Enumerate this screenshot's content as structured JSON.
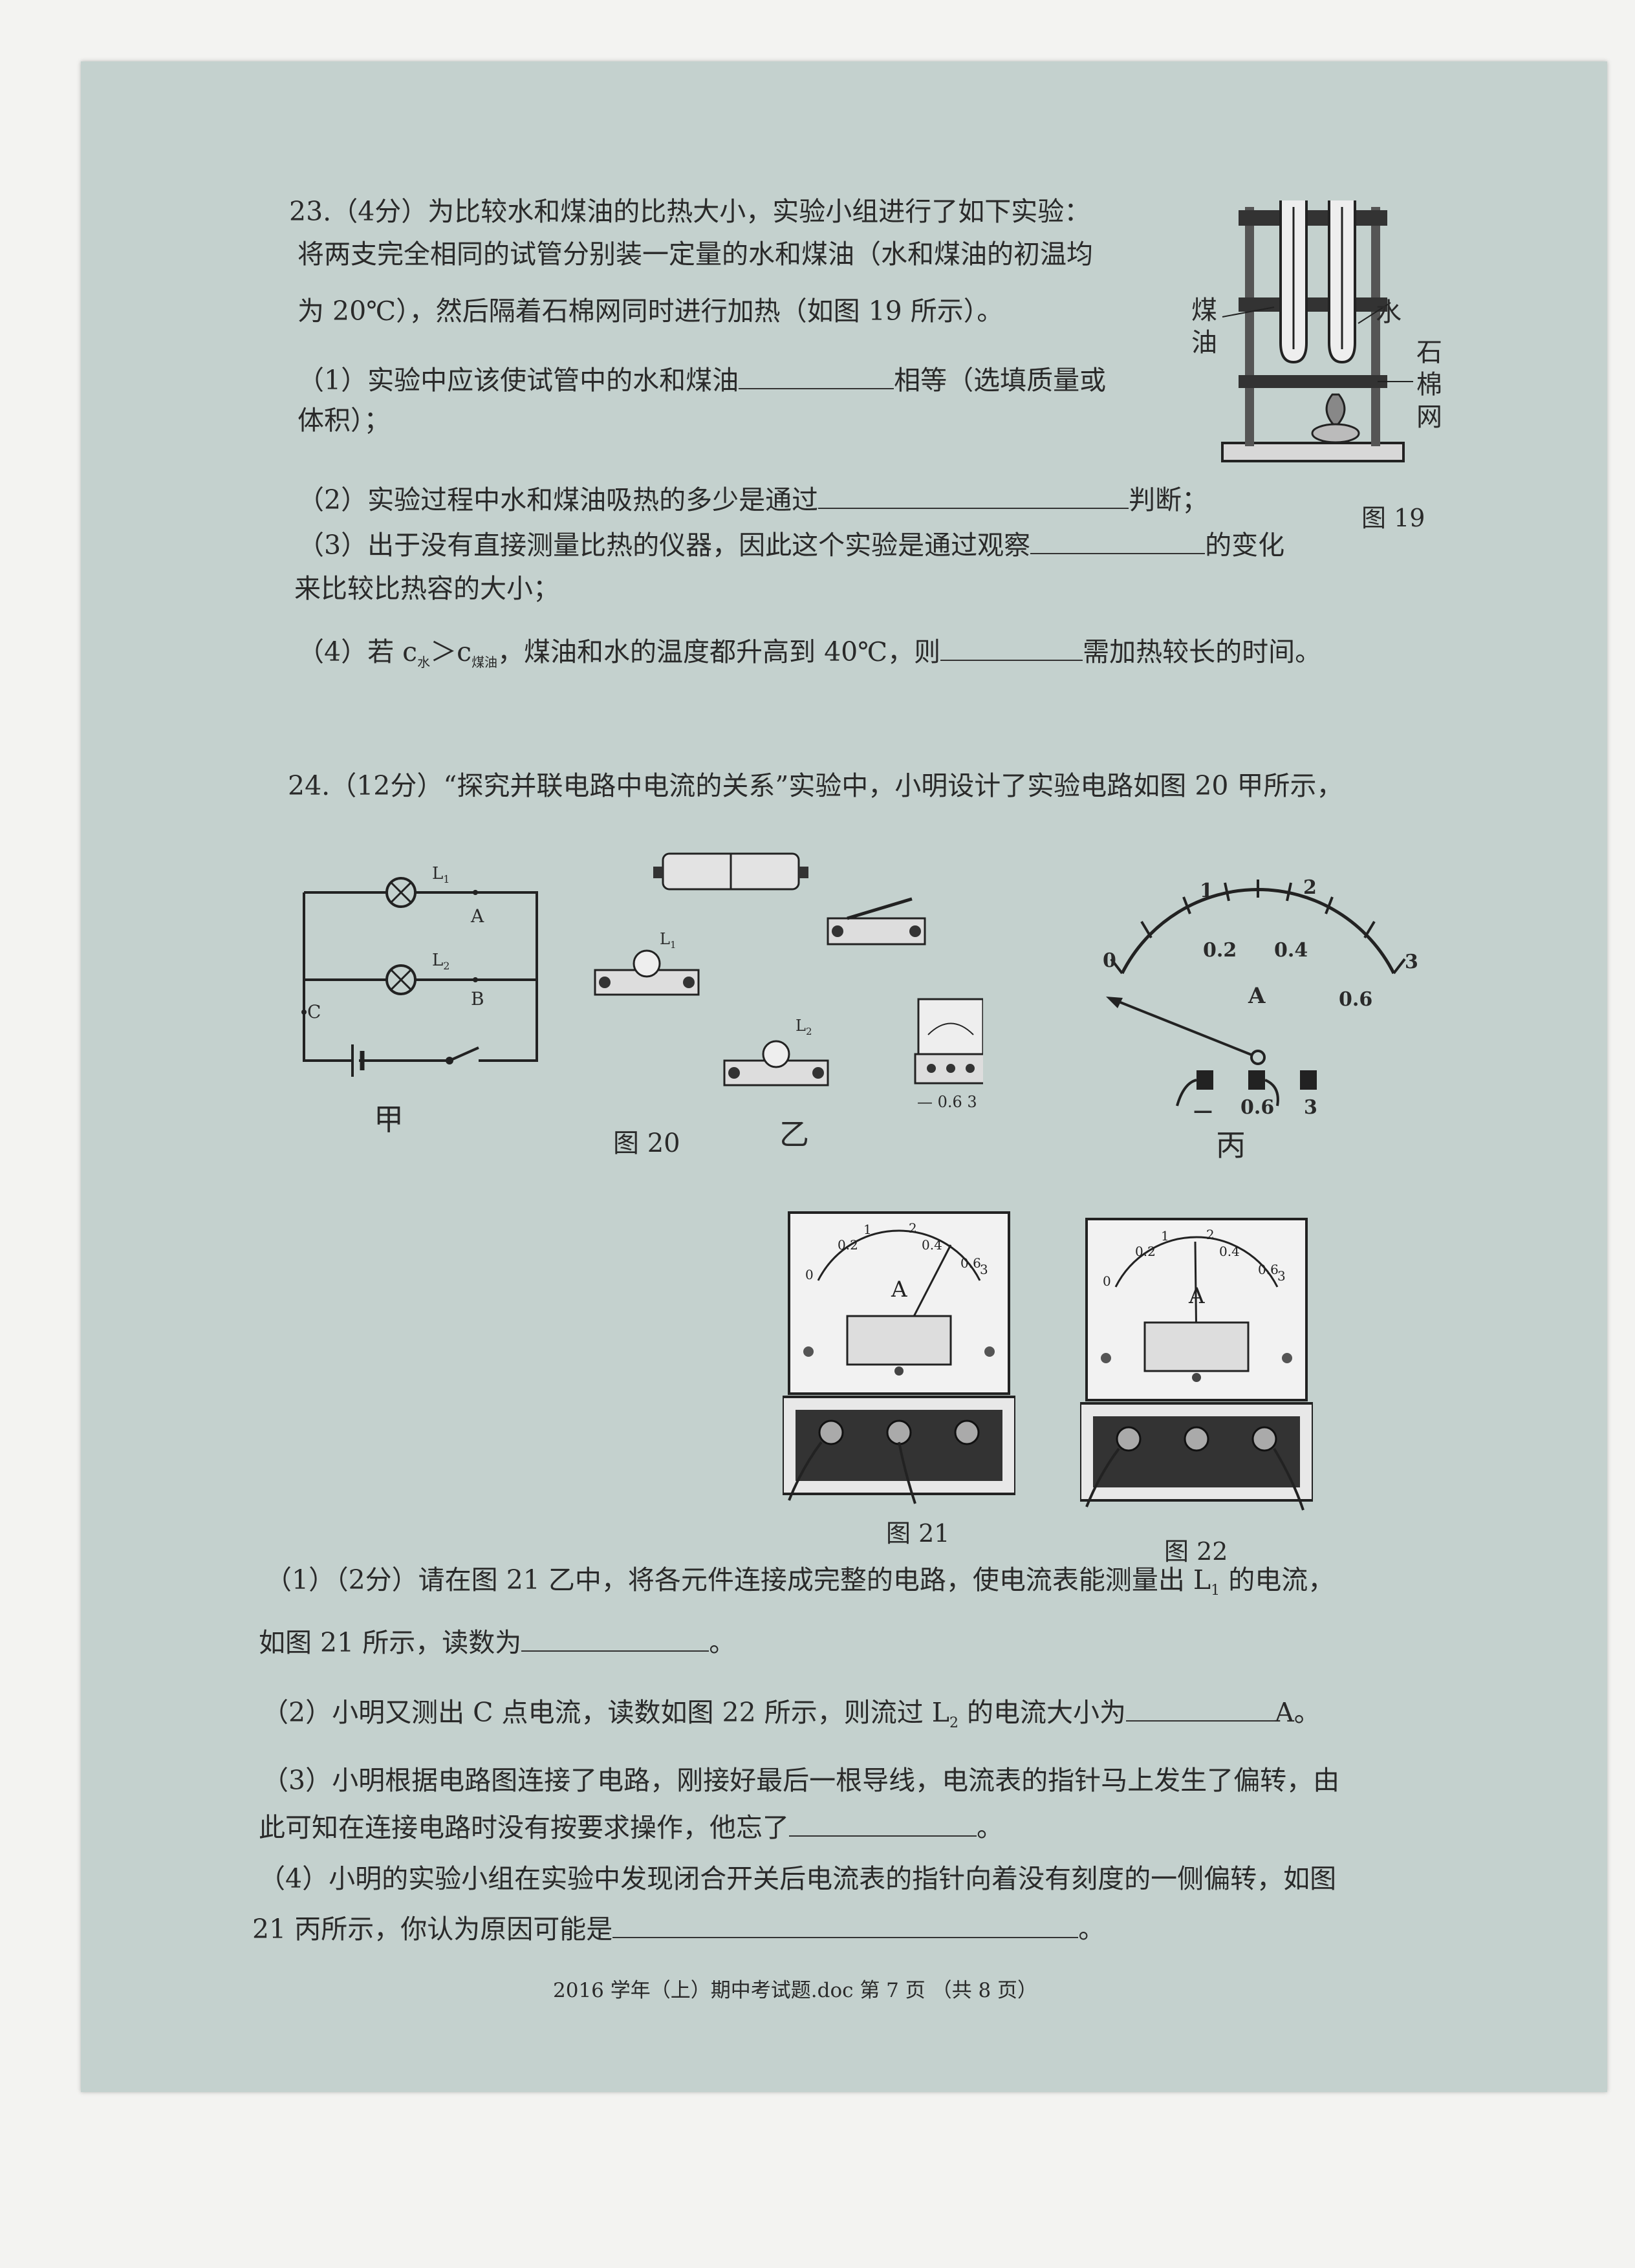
{
  "q23": {
    "line1": "23.（4分）为比较水和煤油的比热大小，实验小组进行了如下实验：",
    "line2": "将两支完全相同的试管分别装一定量的水和煤油（水和煤油的初温均",
    "line3": "为 20℃），然后隔着石棉网同时进行加热（如图 19 所示）。",
    "p1a": "（1）实验中应该使试管中的水和煤油",
    "p1b": "相等（选填质量或",
    "p1c": "体积）；",
    "p2a": "（2）实验过程中水和煤油吸热的多少是通过",
    "p2b": "判断；",
    "p3a": "（3）出于没有直接测量比热的仪器，因此这个实验是通过观察",
    "p3b": "的变化",
    "p3c": "来比较比热容的大小；",
    "p4a": "（4）若 c",
    "p4sub1": "水",
    "p4op": "＞c",
    "p4sub2": "煤油",
    "p4b": "，煤油和水的温度都升高到 40℃，则",
    "p4c": "需加热较长的时间。"
  },
  "fig19": {
    "label_kerosene_1": "煤",
    "label_kerosene_2": "油",
    "label_water": "水",
    "label_gauze_1": "石",
    "label_gauze_2": "棉",
    "label_gauze_3": "网",
    "caption": "图 19"
  },
  "q24": {
    "intro": "24.（12分）“探究并联电路中电流的关系”实验中，小明设计了实验电路如图 20 甲所示，",
    "p1a": "（1）（2分）请在图 21 乙中，将各元件连接成完整的电路，使电流表能测量出 L",
    "p1sub": "1",
    "p1b": " 的电流，",
    "p1c": "如图 21 所示，读数为",
    "p1d": "。",
    "p2a": "（2）小明又测出 C 点电流，读数如图 22 所示，则流过 L",
    "p2sub": "2",
    "p2b": " 的电流大小为",
    "p2c": "A。",
    "p3a": "（3）小明根据电路图连接了电路，刚接好最后一根导线，电流表的指针马上发生了偏转，由",
    "p3b": "此可知在连接电路时没有按要求操作，他忘了",
    "p3c": "。",
    "p4a": "（4）小明的实验小组在实验中发现闭合开关后电流表的指针向着没有刻度的一侧偏转，如图",
    "p4b": "21 丙所示，你认为原因可能是",
    "p4c": "。"
  },
  "fig20": {
    "L1": "L",
    "L1sub": "1",
    "L2": "L",
    "L2sub": "2",
    "A": "A",
    "B": "B",
    "C": "C",
    "jia": "甲",
    "yi": "乙",
    "bing": "丙",
    "caption": "图 20",
    "meter_terms": "— 0.6  3",
    "scale_0": "0",
    "scale_1": "1",
    "scale_2": "2",
    "scale_3": "3",
    "scale_02": "0.2",
    "scale_04": "0.4",
    "scale_06": "0.6",
    "unit": "A",
    "term_minus": "—",
    "term_06": "0.6",
    "term_3": "3"
  },
  "fig21": {
    "caption": "图 21"
  },
  "fig22": {
    "caption": "图 22"
  },
  "footer": "2016 学年（上）期中考试题.doc    第 7 页  （共 8 页）"
}
